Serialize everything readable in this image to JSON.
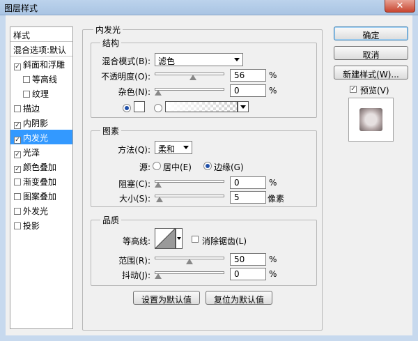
{
  "window": {
    "title": "图层样式",
    "close_glyph": "✕"
  },
  "stylelist": {
    "header": "样式",
    "blend_options": "混合选项:默认",
    "items": [
      {
        "label": "斜面和浮雕",
        "checked": true,
        "indent": false
      },
      {
        "label": "等高线",
        "checked": false,
        "indent": true
      },
      {
        "label": "纹理",
        "checked": false,
        "indent": true
      },
      {
        "label": "描边",
        "checked": false,
        "indent": false
      },
      {
        "label": "内阴影",
        "checked": true,
        "indent": false
      },
      {
        "label": "内发光",
        "checked": true,
        "indent": false,
        "selected": true
      },
      {
        "label": "光泽",
        "checked": true,
        "indent": false
      },
      {
        "label": "颜色叠加",
        "checked": true,
        "indent": false
      },
      {
        "label": "渐变叠加",
        "checked": false,
        "indent": false
      },
      {
        "label": "图案叠加",
        "checked": false,
        "indent": false
      },
      {
        "label": "外发光",
        "checked": false,
        "indent": false
      },
      {
        "label": "投影",
        "checked": false,
        "indent": false
      }
    ]
  },
  "panel": {
    "title": "内发光",
    "structure": {
      "legend": "结构",
      "blend_mode_label": "混合模式(B):",
      "blend_mode_value": "滤色",
      "opacity_label": "不透明度(O):",
      "opacity_value": "56",
      "opacity_unit": "%",
      "opacity_fraction": 0.56,
      "noise_label": "杂色(N):",
      "noise_value": "0",
      "noise_unit": "%",
      "noise_fraction": 0.0,
      "color_mode": "solid",
      "glow_color": "#ffffff"
    },
    "elements": {
      "legend": "图素",
      "technique_label": "方法(Q):",
      "technique_value": "柔和",
      "source_label": "源:",
      "source_center": "居中(E)",
      "source_edge": "边缘(G)",
      "source_selected": "edge",
      "choke_label": "阻塞(C):",
      "choke_value": "0",
      "choke_unit": "%",
      "choke_fraction": 0.0,
      "size_label": "大小(S):",
      "size_value": "5",
      "size_unit": "像素",
      "size_fraction": 0.02
    },
    "quality": {
      "legend": "品质",
      "contour_label": "等高线:",
      "antialias_label": "消除锯齿(L)",
      "antialias_checked": false,
      "range_label": "范围(R):",
      "range_value": "50",
      "range_unit": "%",
      "range_fraction": 0.5,
      "jitter_label": "抖动(J):",
      "jitter_value": "0",
      "jitter_unit": "%",
      "jitter_fraction": 0.0
    },
    "make_default": "设置为默认值",
    "reset_default": "复位为默认值"
  },
  "buttons": {
    "ok": "确定",
    "cancel": "取消",
    "new_style": "新建样式(W)...",
    "preview_label": "预览(V)",
    "preview_checked": true
  },
  "colors": {
    "selection": "#3399ff",
    "titlebar": "#a9c4e3",
    "close": "#c8452f"
  }
}
